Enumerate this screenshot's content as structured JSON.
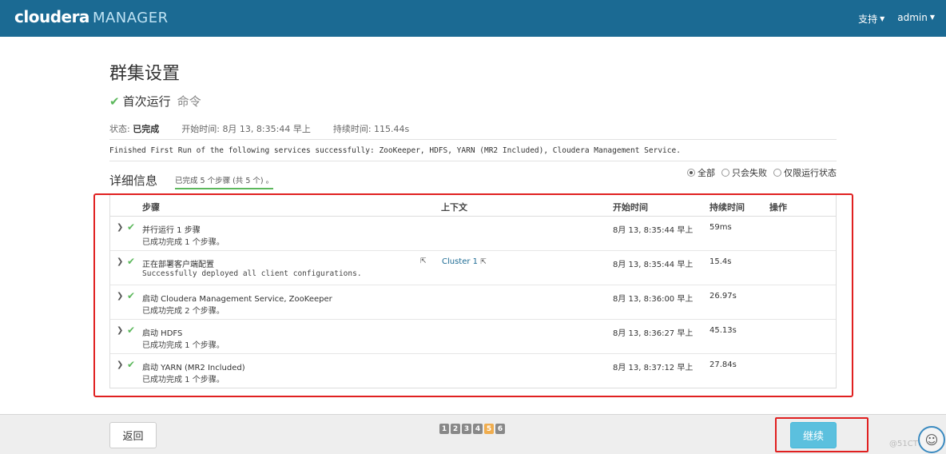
{
  "header": {
    "brand": "cloudera",
    "brand_suffix": "MANAGER",
    "support_label": "支持",
    "user_label": "admin"
  },
  "page": {
    "title": "群集设置",
    "subtitle": "首次运行",
    "subtitle_muted": "命令"
  },
  "status": {
    "state_label": "状态:",
    "state_value": "已完成",
    "start_label": "开始时间:",
    "start_value": "8月 13, 8:35:44 早上",
    "duration_label": "持续时间:",
    "duration_value": "115.44s"
  },
  "message": "Finished First Run of the following services successfully: ZooKeeper, HDFS, YARN (MR2 Included), Cloudera Management Service.",
  "details": {
    "title": "详细信息",
    "summary": "已完成 5 个步骤 (共 5 个) 。",
    "filters": [
      "全部",
      "只会失败",
      "仅限运行状态"
    ],
    "selected_filter": "全部"
  },
  "table": {
    "headers": [
      "步骤",
      "上下文",
      "开始时间",
      "持续时间",
      "操作"
    ],
    "rows": [
      {
        "name": "并行运行 1 步骤",
        "desc": "已成功完成 1 个步骤。",
        "context": "",
        "start": "8月 13, 8:35:44 早上",
        "duration": "59ms"
      },
      {
        "name": "正在部署客户端配置",
        "desc": "Successfully deployed all client configurations.",
        "context": "Cluster 1",
        "start": "8月 13, 8:35:44 早上",
        "duration": "15.4s"
      },
      {
        "name": "启动 Cloudera Management Service, ZooKeeper",
        "desc": "已成功完成 2 个步骤。",
        "context": "",
        "start": "8月 13, 8:36:00 早上",
        "duration": "26.97s"
      },
      {
        "name": "启动 HDFS",
        "desc": "已成功完成 1 个步骤。",
        "context": "",
        "start": "8月 13, 8:36:27 早上",
        "duration": "45.13s"
      },
      {
        "name": "启动 YARN (MR2 Included)",
        "desc": "已成功完成 1 个步骤。",
        "context": "",
        "start": "8月 13, 8:37:12 早上",
        "duration": "27.84s"
      }
    ]
  },
  "footer": {
    "back_label": "返回",
    "continue_label": "继续",
    "pages": [
      "1",
      "2",
      "3",
      "4",
      "5",
      "6"
    ],
    "active_page": "5",
    "watermark": "@51CT"
  },
  "colors": {
    "topbar": "#1b6a93",
    "success": "#5cb85c",
    "highlight": "#e02020",
    "primary_button": "#5bc0de",
    "active_page": "#f0ad4e"
  }
}
